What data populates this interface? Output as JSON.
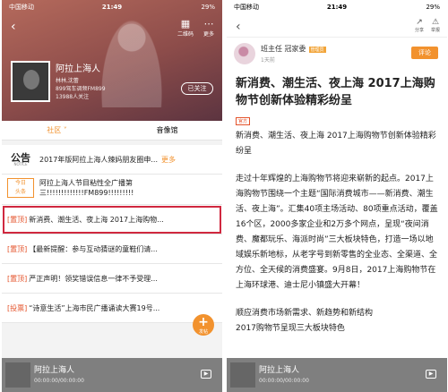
{
  "status_left": {
    "carrier": "中国移动",
    "time": "21:49",
    "battery": "29%"
  },
  "status_right": {
    "carrier": "中国移动",
    "time": "21:49",
    "battery": "29%"
  },
  "left": {
    "header_icons": [
      {
        "icon": "qr-icon",
        "label": "二维码"
      },
      {
        "icon": "more-icon",
        "label": "更多"
      }
    ],
    "station_name": "阿拉上海人",
    "station_meta_1": "林林,沈蕾",
    "station_meta_2": "899驾车调频FM899",
    "station_meta_3": "13988人关注",
    "follow_label": "已关注",
    "tabs": [
      {
        "label": "社区"
      },
      {
        "label": "音像馆"
      }
    ],
    "notice": {
      "big": "公告",
      "small": "NOTICE",
      "text": "2017年版阿拉上海人辣妈朋友圈申...",
      "more": "更多"
    },
    "today": {
      "line1": "今日",
      "line2": "头条",
      "text": "阿拉上海人节目粘性全广播第三!!!!!!!!!!!!!FM899!!!!!!!!!"
    },
    "pinned": [
      {
        "tag": "[置顶]",
        "text": "新消费、潮生活、夜上海 2017上海购物..."
      },
      {
        "tag": "[置顶]",
        "text": "【最新提醒：参与互动猜谜的童鞋们请..."
      },
      {
        "tag": "[置顶]",
        "text": "严正声明！领奖错误信息一律不予受理..."
      },
      {
        "tag": "[投票]",
        "text": "“诗意生活”上海市民广播诵读大赛19号..."
      }
    ],
    "fab": {
      "symbol": "+",
      "label": "发帖"
    }
  },
  "right": {
    "topbar_icons": [
      {
        "icon": "share-icon",
        "label": "分享"
      },
      {
        "icon": "report-icon",
        "label": "举报"
      }
    ],
    "author": {
      "name": "班主任 冠家委",
      "role": "管理员",
      "time": "1天前"
    },
    "comment_label": "评论",
    "title": "新消费、潮生活、夜上海 2017上海购物节创新体验精彩纷呈",
    "official_tag": "官方",
    "summary": "新消费、潮生活、夜上海 2017上海购物节创新体验精彩纷呈",
    "body_1": "走过十年辉煌的上海购物节将迎来崭新的起点。2017上海购物节围绕一个主题“国际消费城市——新消费、潮生活、夜上海”。汇集40项主场活动、80项重点活动，覆盖16个区，2000多家企业和2万多个网点，呈现“夜间消费、魔都玩乐、海派时尚”三大板块特色，打造一场以地域娱乐新地标，从老字号到新零售的全业态、全渠道、全方位、全天候的消费盛宴。9月8日，2017上海购物节在上海环球港、迪士尼小镇盛大开幕！",
    "body_2": "顺应消费市场新需求、新趋势和新结构",
    "body_3": "2017购物节呈现三大板块特色"
  },
  "player": {
    "title": "阿拉上海人",
    "time": "00:00:00/00:00:00"
  }
}
